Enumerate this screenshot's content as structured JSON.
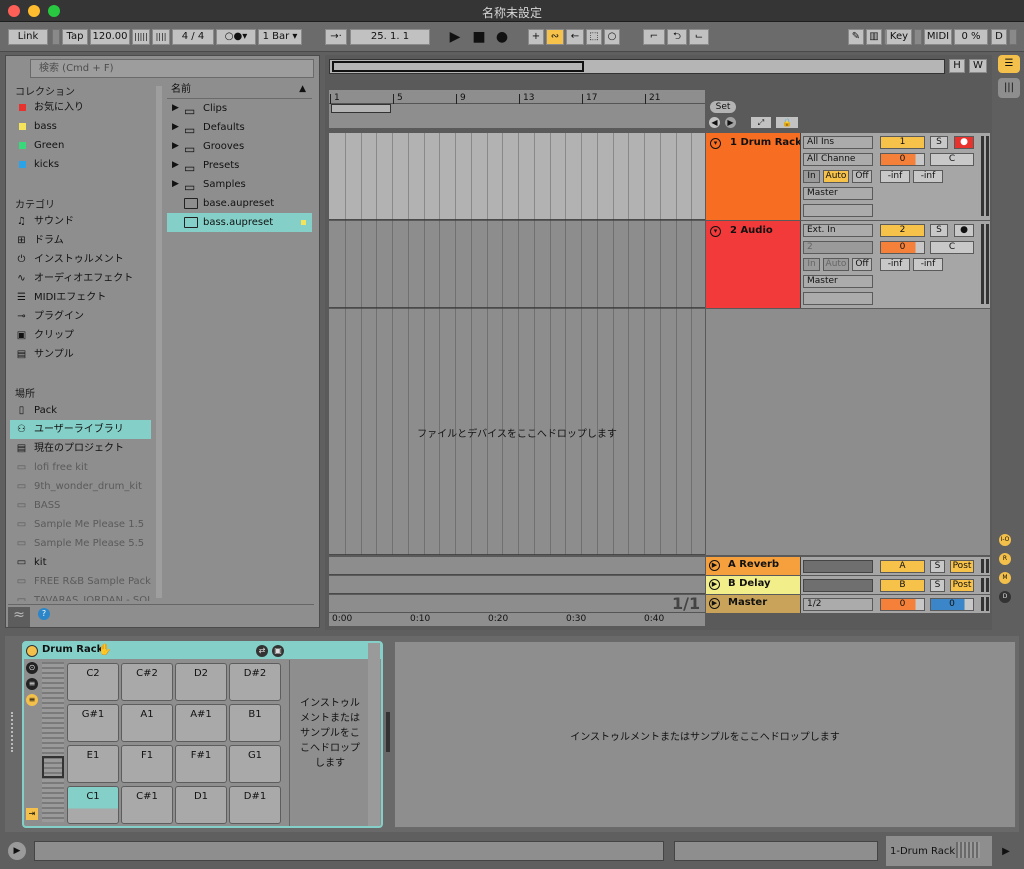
{
  "window": {
    "title": "名称未設定"
  },
  "control_bar": {
    "link": "Link",
    "tap": "Tap",
    "tempo": "120.00",
    "signature": "4 / 4",
    "quantize": "1 Bar",
    "position": "25.  1.  1",
    "key": "Key",
    "midi": "MIDI",
    "cpu": "0 %",
    "disk": "D"
  },
  "browser": {
    "search_placeholder": "検索 (Cmd + F)",
    "collections_header": "コレクション",
    "collections": [
      {
        "label": "お気に入り",
        "color": "#e8322e"
      },
      {
        "label": "bass",
        "color": "#f5e45b"
      },
      {
        "label": "Green",
        "color": "#38d97b"
      },
      {
        "label": "kicks",
        "color": "#2ba3e8"
      }
    ],
    "categories_header": "カテゴリ",
    "categories": [
      {
        "label": "サウンド",
        "icon": "music-note-icon"
      },
      {
        "label": "ドラム",
        "icon": "drum-grid-icon"
      },
      {
        "label": "インストゥルメント",
        "icon": "power-icon"
      },
      {
        "label": "オーディオエフェクト",
        "icon": "waveform-icon"
      },
      {
        "label": "MIDIエフェクト",
        "icon": "midi-icon"
      },
      {
        "label": "プラグイン",
        "icon": "plugin-icon"
      },
      {
        "label": "クリップ",
        "icon": "clip-icon"
      },
      {
        "label": "サンプル",
        "icon": "sample-icon"
      }
    ],
    "places_header": "場所",
    "places": [
      {
        "label": "Pack",
        "icon": "pack-icon",
        "style": ""
      },
      {
        "label": "ユーザーライブラリ",
        "icon": "user-icon",
        "style": "sel"
      },
      {
        "label": "現在のプロジェクト",
        "icon": "project-icon",
        "style": ""
      },
      {
        "label": "lofi free kit",
        "icon": "folder-icon",
        "style": "dim"
      },
      {
        "label": "9th_wonder_drum_kit",
        "icon": "folder-icon",
        "style": "dim"
      },
      {
        "label": "BASS",
        "icon": "folder-icon",
        "style": "dim"
      },
      {
        "label": "Sample Me Please 1.5",
        "icon": "folder-icon",
        "style": "dim"
      },
      {
        "label": "Sample Me Please 5.5",
        "icon": "folder-icon",
        "style": "dim"
      },
      {
        "label": "kit",
        "icon": "folder-icon",
        "style": ""
      },
      {
        "label": "FREE R&B Sample Pack",
        "icon": "folder-icon",
        "style": "dim"
      },
      {
        "label": "TAVARAS_JORDAN - SOL",
        "icon": "folder-icon",
        "style": "dim"
      }
    ],
    "name_header": "名前",
    "files": [
      {
        "label": "Clips",
        "type": "folder"
      },
      {
        "label": "Defaults",
        "type": "folder"
      },
      {
        "label": "Grooves",
        "type": "folder"
      },
      {
        "label": "Presets",
        "type": "folder"
      },
      {
        "label": "Samples",
        "type": "folder"
      },
      {
        "label": "base.aupreset",
        "type": "preset"
      },
      {
        "label": "bass.aupreset",
        "type": "preset-selected"
      }
    ]
  },
  "arrangement": {
    "bar_numbers": [
      "1",
      "5",
      "9",
      "13",
      "17",
      "21"
    ],
    "set_label": "Set",
    "drop_hint": "ファイルとデバイスをここへドロップします",
    "page_counter": "1/1",
    "time_labels": [
      "0:00",
      "0:10",
      "0:20",
      "0:30",
      "0:40"
    ],
    "overview_buttons": [
      "H",
      "W"
    ]
  },
  "tracks": [
    {
      "name": "1 Drum Rack",
      "color": "#f76e22",
      "input_type": "All Ins",
      "input_channel": "All Channe",
      "monitor": [
        "In",
        "Auto",
        "Off"
      ],
      "output": "Master",
      "number": "1",
      "solo": "S",
      "arm": "●",
      "pan": "C",
      "volume": "0",
      "peak_left": "-inf",
      "peak_right": "-inf"
    },
    {
      "name": "2 Audio",
      "color": "#f23a3a",
      "input_type": "Ext. In",
      "input_channel": "2",
      "monitor": [
        "In",
        "Auto",
        "Off"
      ],
      "output": "Master",
      "number": "2",
      "solo": "S",
      "arm": "●",
      "pan": "C",
      "volume": "0",
      "peak_left": "-inf",
      "peak_right": "-inf"
    }
  ],
  "returns": [
    {
      "name": "A Reverb",
      "color": "#f5a03c",
      "letter": "A",
      "solo": "S",
      "post": "Post"
    },
    {
      "name": "B Delay",
      "color": "#f2ef8a",
      "letter": "B",
      "solo": "S",
      "post": "Post"
    }
  ],
  "master": {
    "name": "Master",
    "color": "#c9a35a",
    "cue": "1/2",
    "volume": "0",
    "pan": "0"
  },
  "side_buttons": [
    "I-O",
    "R",
    "M",
    "D"
  ],
  "device": {
    "name": "Drum Rack",
    "pads": [
      [
        "C2",
        "C#2",
        "D2",
        "D#2"
      ],
      [
        "G#1",
        "A1",
        "A#1",
        "B1"
      ],
      [
        "E1",
        "F1",
        "F#1",
        "G1"
      ],
      [
        "C1",
        "C#1",
        "D1",
        "D#1"
      ]
    ],
    "drop_hint_small": "インストゥルメントまたはサンプルをここへドロップします",
    "drop_hint_large": "インストゥルメントまたはサンプルをここへドロップします"
  },
  "status": {
    "selected_track": "1-Drum Rack"
  }
}
